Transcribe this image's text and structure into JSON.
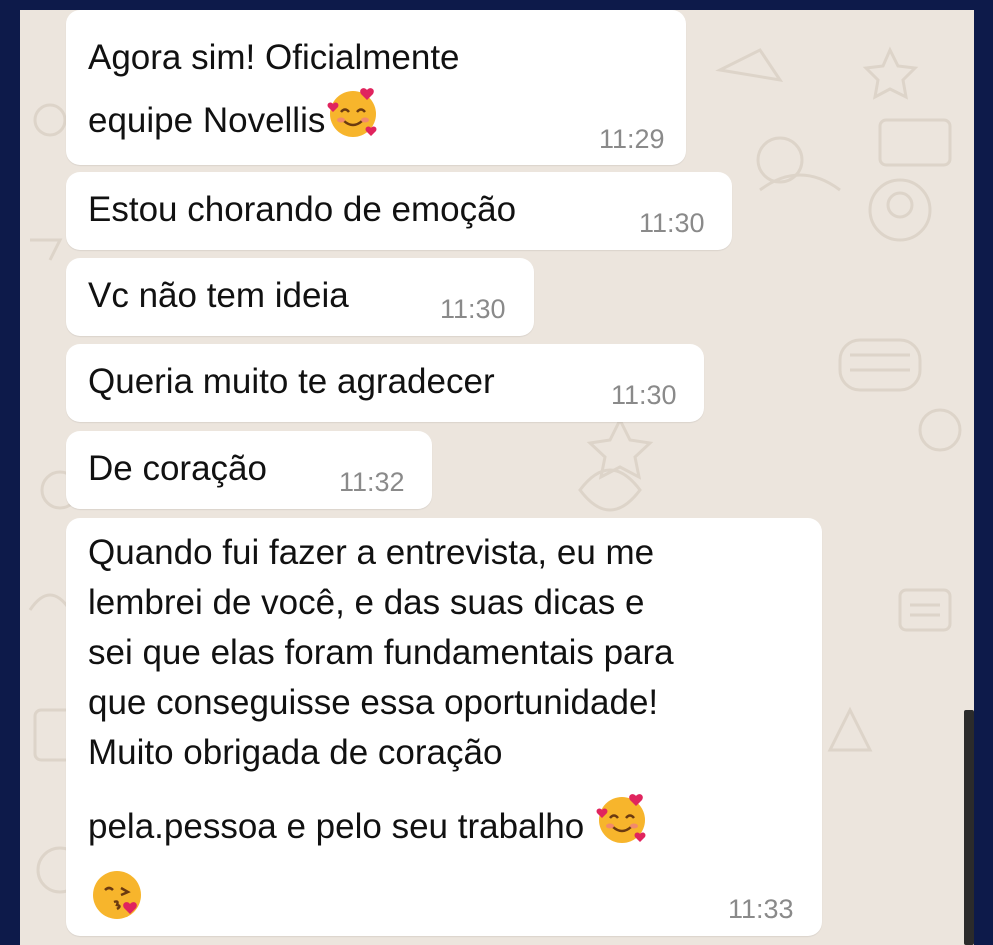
{
  "messages": [
    {
      "line1": "Agora sim! Oficialmente",
      "line2": "equipe Novellis",
      "emoji": "smiling-hearts-icon",
      "time": "11:29"
    },
    {
      "text": "Estou chorando de emoção",
      "time": "11:30"
    },
    {
      "text": "Vc não tem ideia",
      "time": "11:30"
    },
    {
      "text": "Queria muito te agradecer",
      "time": "11:30"
    },
    {
      "text": "De coração",
      "time": "11:32"
    },
    {
      "lines": [
        "Quando fui fazer a entrevista, eu me",
        "lembrei de você, e das suas dicas e",
        "sei que elas foram fundamentais para",
        "que conseguisse essa oportunidade!",
        "Muito obrigada de coração",
        "pela.pessoa e pelo seu trabalho"
      ],
      "emojis": [
        "smiling-hearts-icon",
        "kissing-heart-icon"
      ],
      "time": "11:33"
    }
  ],
  "colors": {
    "chat_background": "#ece5dd",
    "bubble": "#ffffff",
    "time_text": "#8a8a8a",
    "page_border": "#0d1a4a"
  }
}
